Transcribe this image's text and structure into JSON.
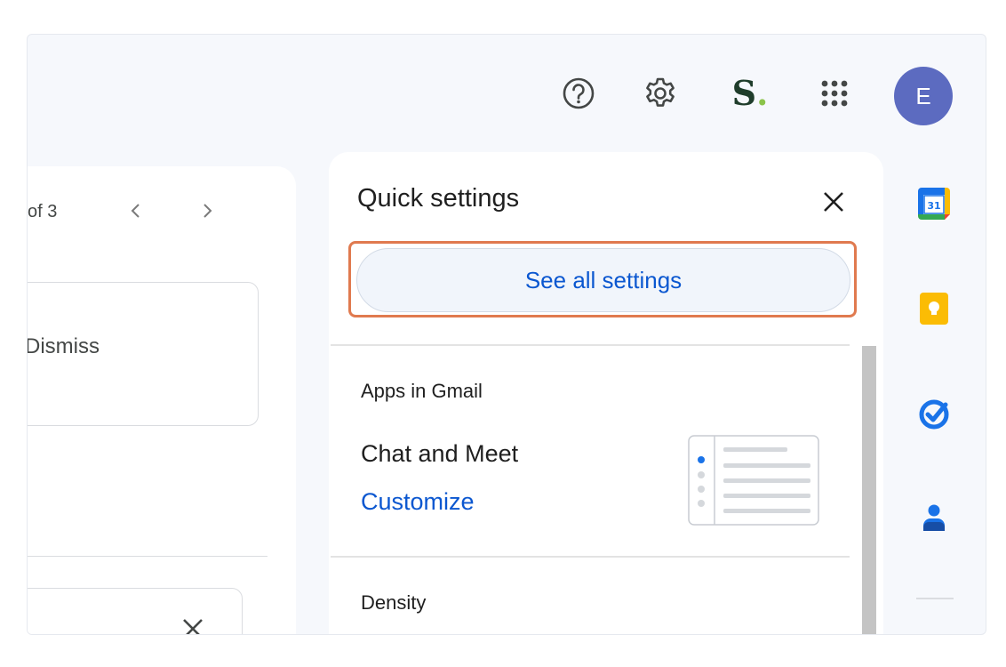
{
  "header": {
    "avatar_initial": "E",
    "brand_letter": "S",
    "brand_dot": "."
  },
  "mail": {
    "pager_text": "of 3",
    "dismiss_label": "Dismiss"
  },
  "quick_settings": {
    "title": "Quick settings",
    "see_all_label": "See all settings",
    "apps_heading": "Apps in Gmail",
    "chat_meet_label": "Chat and Meet",
    "customize_label": "Customize",
    "density_heading": "Density"
  },
  "icons": {
    "help": "help-icon",
    "settings": "gear-icon",
    "apps": "apps-grid-icon",
    "close": "close-icon",
    "calendar": "calendar-icon",
    "keep": "keep-icon",
    "tasks": "tasks-icon",
    "contacts": "contacts-icon"
  },
  "colors": {
    "accent_blue": "#0b57d0",
    "highlight": "#e07a4f",
    "avatar": "#5c6bc0"
  }
}
